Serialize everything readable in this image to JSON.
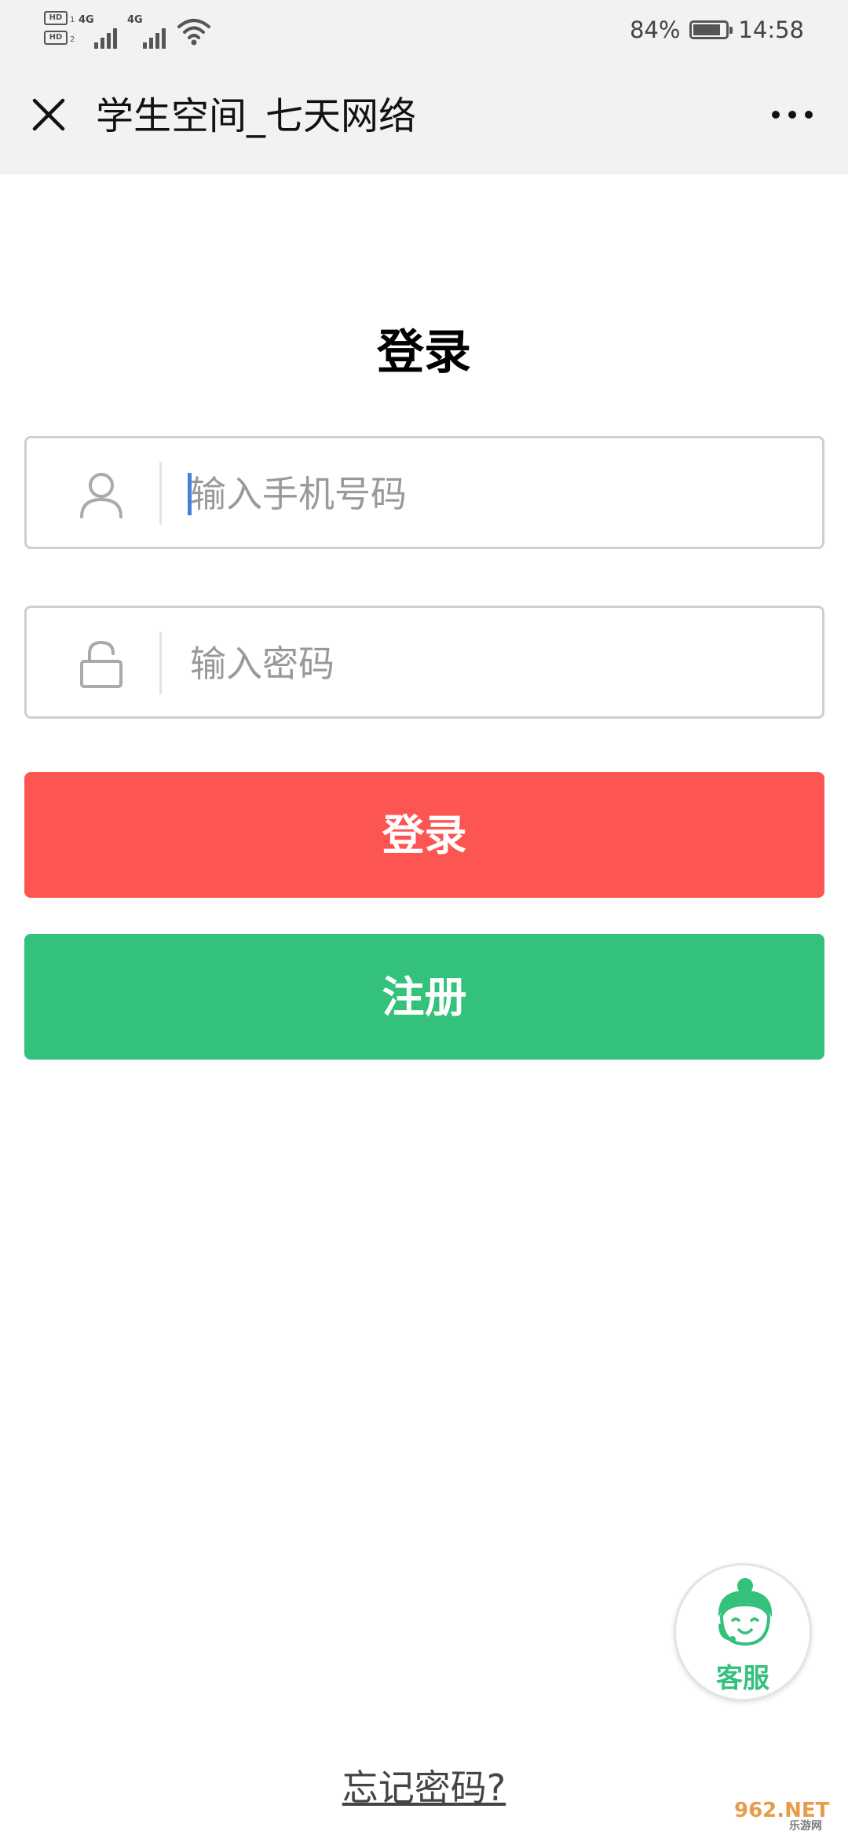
{
  "status_bar": {
    "hd1": "HD",
    "hd1_sub": "1",
    "hd2": "HD",
    "hd2_sub": "2",
    "net1": "4G",
    "net2": "4G",
    "battery_percent": "84%",
    "battery_level": 0.84,
    "time": "14:58"
  },
  "header": {
    "title": "学生空间_七天网络",
    "close_icon": "close-icon",
    "more_icon": "more-icon"
  },
  "login": {
    "heading": "登录",
    "phone_placeholder": "输入手机号码",
    "password_placeholder": "输入密码",
    "login_button": "登录",
    "register_button": "注册",
    "forgot_password": "忘记密码?"
  },
  "support": {
    "label": "客服",
    "icon": "customer-service-icon"
  },
  "watermark": {
    "text": "962.NET",
    "sub": "乐游网"
  },
  "colors": {
    "login_button": "#fd5552",
    "register_button": "#33c17b",
    "header_bg": "#f2f2f2",
    "caret": "#4a7fd8"
  }
}
